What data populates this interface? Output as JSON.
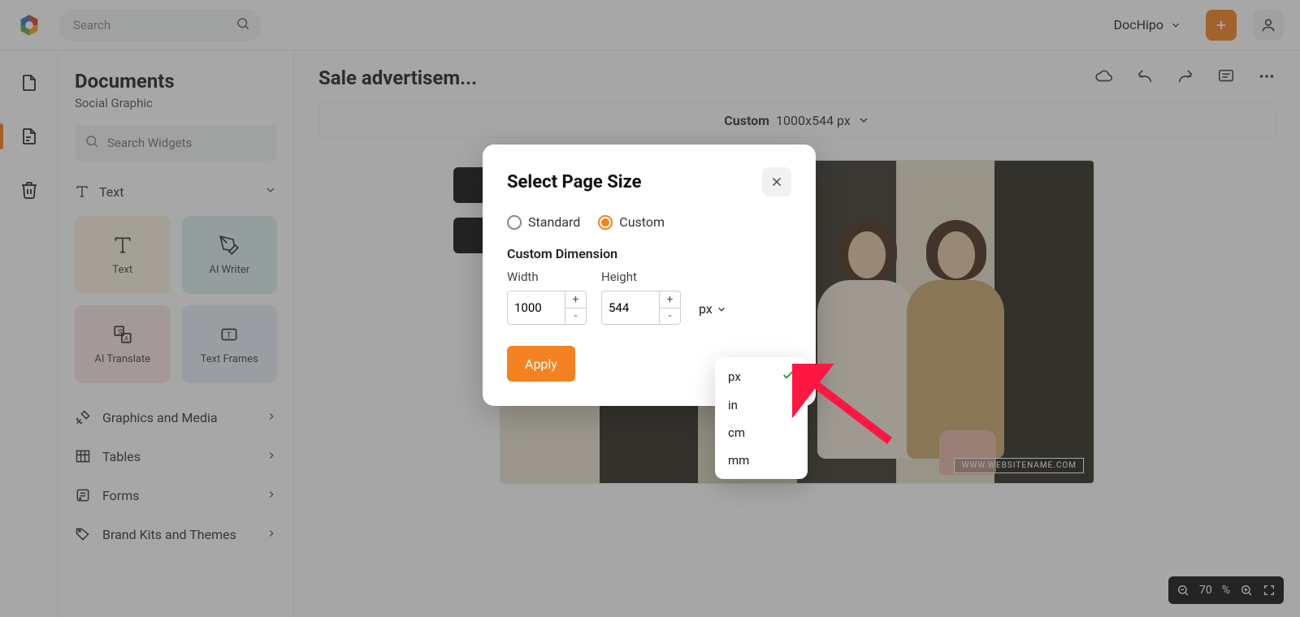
{
  "topbar": {
    "search_placeholder": "Search",
    "brand_label": "DocHipo"
  },
  "sidepanel": {
    "title": "Documents",
    "subtitle": "Social Graphic",
    "search_placeholder": "Search Widgets",
    "section_text": "Text",
    "widgets": {
      "text": "Text",
      "ai_writer": "AI Writer",
      "ai_translate": "AI Translate",
      "text_frames": "Text Frames"
    },
    "rows": {
      "graphics": "Graphics and Media",
      "tables": "Tables",
      "forms": "Forms",
      "brand": "Brand Kits and Themes"
    }
  },
  "document": {
    "title": "Sale advertisem...",
    "size_label": "Custom",
    "size_value": "1000x544 px",
    "watermark": "WWW.WEBSITENAME.COM"
  },
  "zoom": {
    "value": "70",
    "pct": "%"
  },
  "modal": {
    "title": "Select Page Size",
    "opt_standard": "Standard",
    "opt_custom": "Custom",
    "custom_dim": "Custom Dimension",
    "width_label": "Width",
    "height_label": "Height",
    "width_value": "1000",
    "height_value": "544",
    "unit_label": "px",
    "apply": "Apply"
  },
  "units": {
    "px": "px",
    "in": "in",
    "cm": "cm",
    "mm": "mm"
  }
}
